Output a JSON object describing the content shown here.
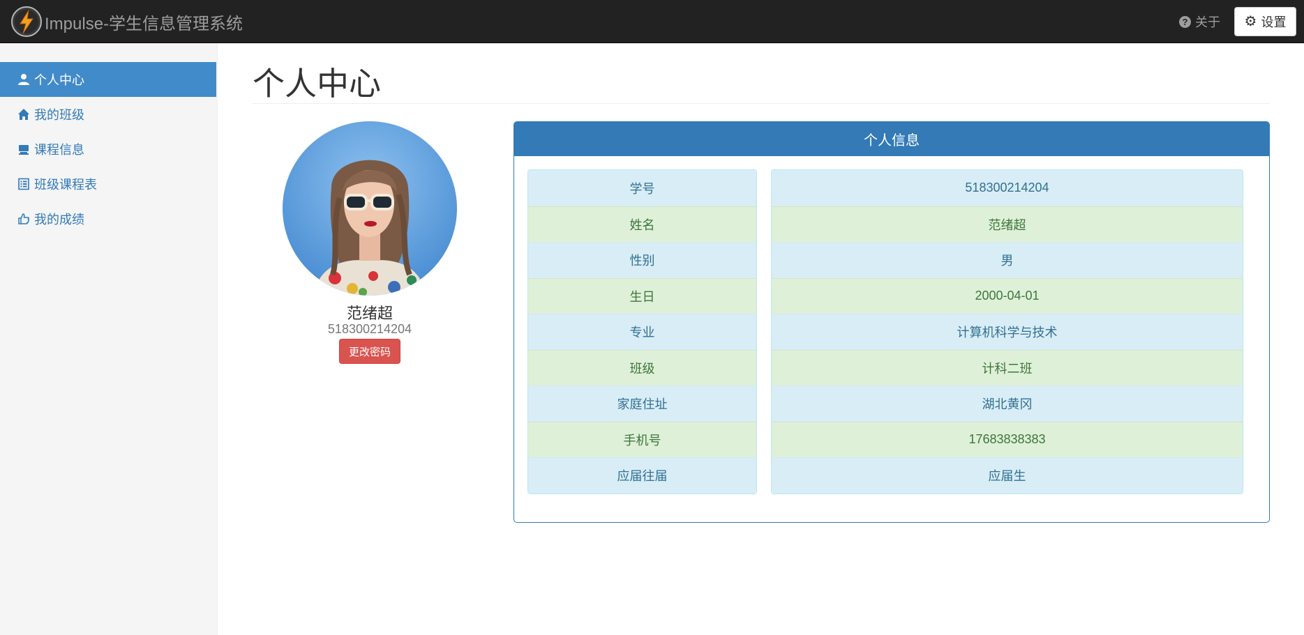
{
  "navbar": {
    "app_title": "Impulse-学生信息管理系统",
    "about_label": "关于",
    "settings_label": "设置"
  },
  "sidebar": {
    "items": [
      {
        "label": "个人中心",
        "icon": "user-icon",
        "active": true
      },
      {
        "label": "我的班级",
        "icon": "home-icon",
        "active": false
      },
      {
        "label": "课程信息",
        "icon": "blackboard-icon",
        "active": false
      },
      {
        "label": "班级课程表",
        "icon": "list-alt-icon",
        "active": false
      },
      {
        "label": "我的成绩",
        "icon": "thumbs-up-icon",
        "active": false
      }
    ]
  },
  "main": {
    "page_title": "个人中心"
  },
  "profile": {
    "name": "范绪超",
    "student_id": "518300214204",
    "change_password_label": "更改密码"
  },
  "info_panel": {
    "title": "个人信息",
    "rows": [
      {
        "label": "学号",
        "value": "518300214204"
      },
      {
        "label": "姓名",
        "value": "范绪超"
      },
      {
        "label": "性别",
        "value": "男"
      },
      {
        "label": "生日",
        "value": "2000-04-01"
      },
      {
        "label": "专业",
        "value": "计算机科学与技术"
      },
      {
        "label": "班级",
        "value": "计科二班"
      },
      {
        "label": "家庭住址",
        "value": "湖北黄冈"
      },
      {
        "label": "手机号",
        "value": "17683838383"
      },
      {
        "label": "应届往届",
        "value": "应届生"
      }
    ]
  },
  "colors": {
    "navbar_bg": "#222222",
    "sidebar_active": "#428bca",
    "panel_primary": "#337ab7",
    "row_info": "#d9edf7",
    "row_success": "#dff0d8",
    "danger_button": "#d9534f"
  }
}
